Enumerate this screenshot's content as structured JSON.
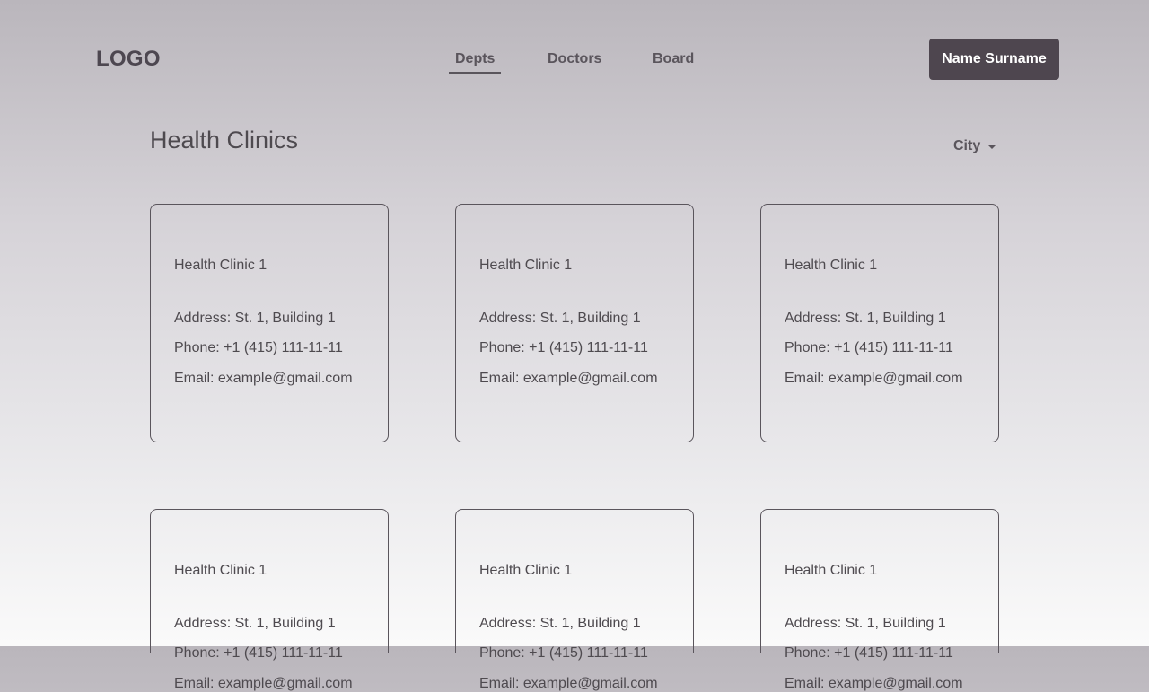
{
  "header": {
    "logo": "LOGO",
    "nav": [
      {
        "label": "Depts",
        "active": true
      },
      {
        "label": "Doctors",
        "active": false
      },
      {
        "label": "Board",
        "active": false
      }
    ],
    "user_button": "Name Surname"
  },
  "main": {
    "title": "Health Clinics",
    "filter_label": "City",
    "filter_icon": "chevron-down-icon",
    "cards": [
      {
        "name": "Health Clinic 1",
        "address": "Address: St. 1, Building 1",
        "phone": "Phone: +1 (415) 111-11-11",
        "email": "Email: example@gmail.com"
      },
      {
        "name": "Health Clinic 1",
        "address": "Address: St. 1, Building 1",
        "phone": "Phone: +1 (415) 111-11-11",
        "email": "Email: example@gmail.com"
      },
      {
        "name": "Health Clinic 1",
        "address": "Address: St. 1, Building 1",
        "phone": "Phone: +1 (415) 111-11-11",
        "email": "Email: example@gmail.com"
      },
      {
        "name": "Health Clinic 1",
        "address": "Address: St. 1, Building 1",
        "phone": "Phone: +1 (415) 111-11-11",
        "email": "Email: example@gmail.com"
      },
      {
        "name": "Health Clinic 1",
        "address": "Address: St. 1, Building 1",
        "phone": "Phone: +1 (415) 111-11-11",
        "email": "Email: example@gmail.com"
      },
      {
        "name": "Health Clinic 1",
        "address": "Address: St. 1, Building 1",
        "phone": "Phone: +1 (415) 111-11-11",
        "email": "Email: example@gmail.com"
      }
    ]
  },
  "colors": {
    "accent": "#4e464f",
    "text": "#4e4a4f",
    "border": "#5a555c"
  }
}
